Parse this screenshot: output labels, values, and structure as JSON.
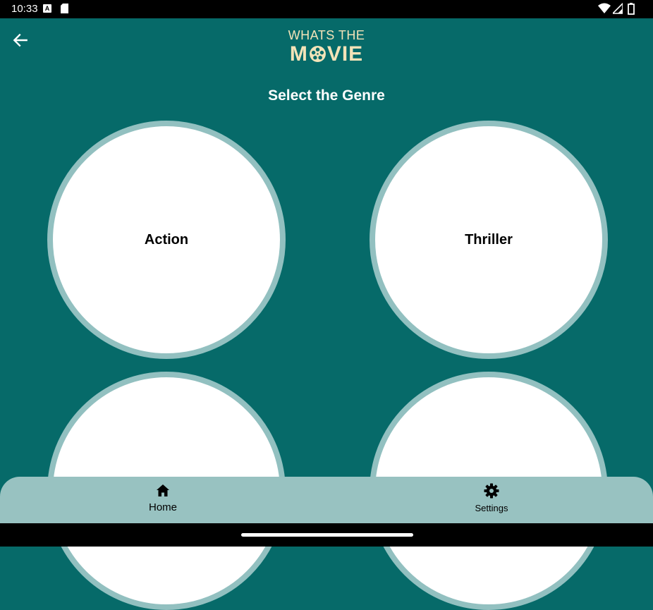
{
  "status_bar": {
    "time": "10:33",
    "a_icon_letter": "A"
  },
  "logo": {
    "line1": "WHATS THE",
    "line2_left": "M",
    "line2_right": "VIE",
    "color": "#f3e3b8"
  },
  "page_title": "Select the Genre",
  "genres": [
    "Action",
    "Thriller",
    "",
    ""
  ],
  "bottom_nav": {
    "home": "Home",
    "settings": "Settings"
  },
  "colors": {
    "background": "#066a69",
    "ring": "#92c0c0",
    "nav": "#98c2c1"
  },
  "icons": [
    "back-arrow-icon",
    "film-reel-icon",
    "home-icon",
    "gear-icon",
    "wifi-icon",
    "signal-icon",
    "battery-icon",
    "sd-card-icon"
  ]
}
